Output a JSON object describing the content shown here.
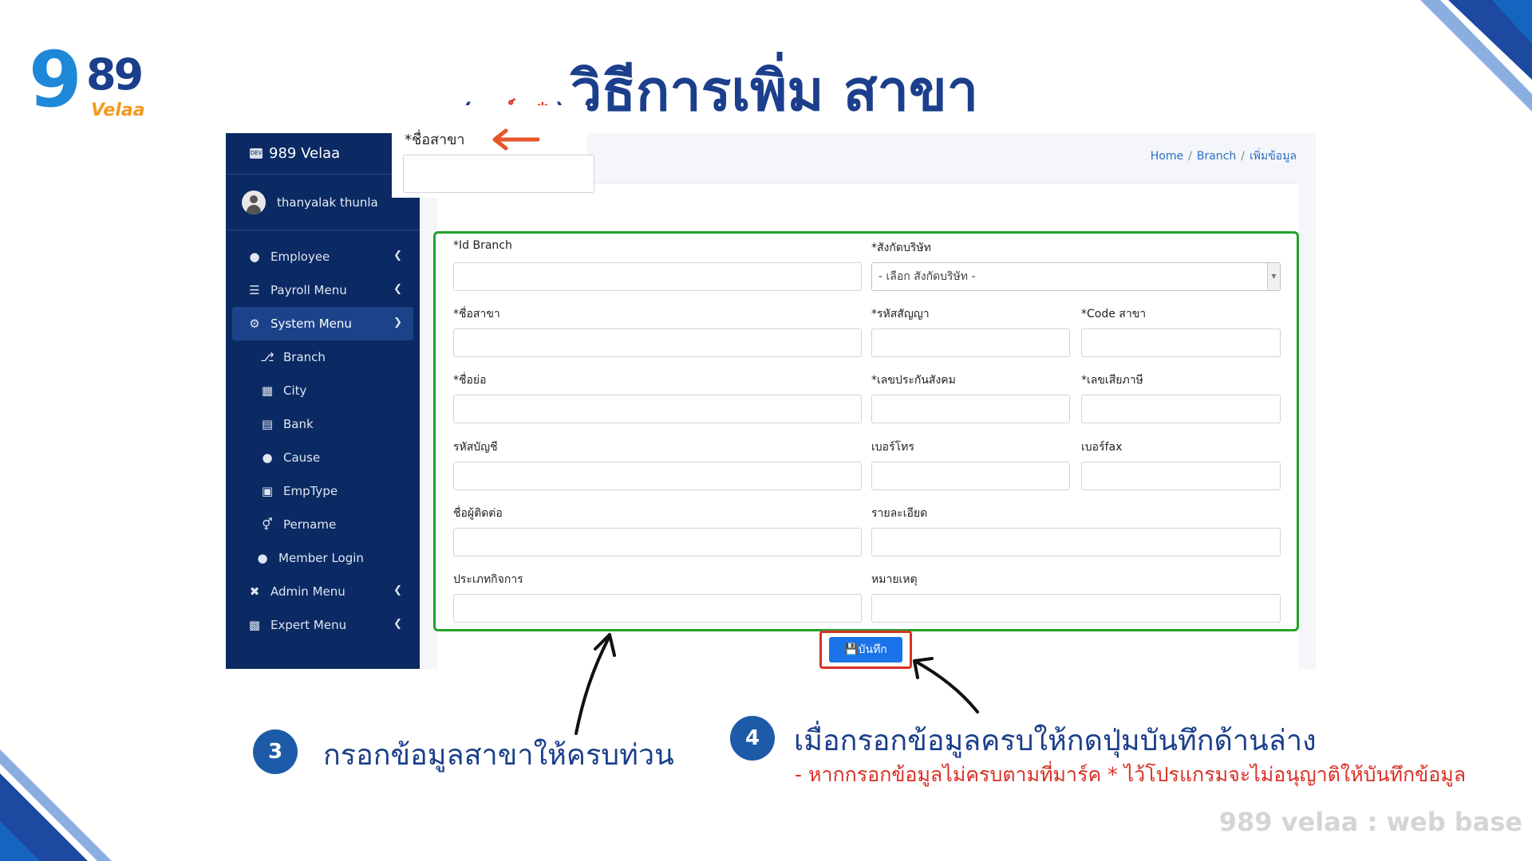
{
  "logo": {
    "nine": "9",
    "digits": "89",
    "velaa": "Velaa"
  },
  "title": "วิธีการเพิ่ม สาขา",
  "mark_note": {
    "open": "( ",
    "mark": "มาร์ค * ",
    "close": ")"
  },
  "callout": {
    "label": "*ชื่อสาขา"
  },
  "app": {
    "brand": "989 Velaa",
    "brand_badge": "DEV",
    "user": "thanyalak thunla",
    "nav": [
      {
        "label": "Employee",
        "icon": "user-icon"
      },
      {
        "label": "Payroll Menu",
        "icon": "paypal-icon"
      },
      {
        "label": "System Menu",
        "icon": "cogs-icon"
      },
      {
        "label": "Branch",
        "icon": "branch-icon"
      },
      {
        "label": "City",
        "icon": "city-icon"
      },
      {
        "label": "Bank",
        "icon": "bank-icon"
      },
      {
        "label": "Cause",
        "icon": "user-minus-icon"
      },
      {
        "label": "EmpType",
        "icon": "chalkboard-icon"
      },
      {
        "label": "Pername",
        "icon": "gender-icon"
      },
      {
        "label": "Member Login",
        "icon": "user-lock-icon"
      },
      {
        "label": "Admin Menu",
        "icon": "tools-icon"
      },
      {
        "label": "Expert Menu",
        "icon": "toolbox-icon"
      }
    ],
    "breadcrumb": {
      "home": "Home",
      "branch": "Branch",
      "current": "เพิ่มข้อมูล"
    },
    "form": {
      "id_branch": "*Id Branch",
      "company": "*สังกัดบริษัท",
      "company_select": "- เลือก สังกัดบริษัท -",
      "branch_name": "*ชื่อสาขา",
      "contract_code": "*รหัสสัญญา",
      "code_branch": "*Code สาขา",
      "abbr": "*ชื่อย่อ",
      "social_security": "*เลขประกันสังคม",
      "tax_no": "*เลขเสียภาษี",
      "account_code": "รหัสบัญชี",
      "phone": "เบอร์โทร",
      "fax": "เบอร์fax",
      "contact_name": "ชื่อผู้ติดต่อ",
      "detail": "รายละเอียด",
      "business_type": "ประเภทกิจการ",
      "remark": "หมายเหตุ"
    },
    "save_label": "บันทึก"
  },
  "steps": [
    {
      "num": "3",
      "text": "กรอกข้อมูลสาขาให้ครบท่วน"
    },
    {
      "num": "4",
      "text": "เมื่อกรอกข้อมูลครบให้กดปุ่มบันทึกด้านล่าง",
      "sub": "- หากกรอกข้อมูลไม่ครบตามที่มาร์ค * ไว้โปรแกรมจะไม่อนุญาติให้บันทึกข้อมูล"
    }
  ],
  "footer": "989 velaa : web base",
  "colors": {
    "brand_blue": "#1b3f8c",
    "sidebar": "#0b2a63",
    "highlight_green": "#23a12a",
    "highlight_red": "#d93025",
    "button_blue": "#1a73e8",
    "arrow_orange": "#e8552a"
  }
}
